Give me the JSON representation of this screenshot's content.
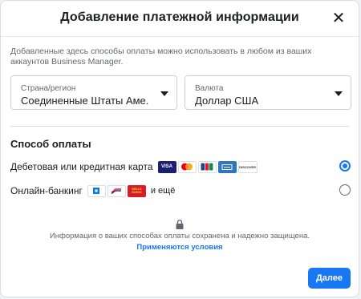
{
  "dialog": {
    "title": "Добавление платежной информации",
    "intro": "Добавленные здесь способы оплаты можно использовать в любом из ваших аккаунтов Business Manager."
  },
  "country": {
    "label": "Страна/регион",
    "value": "Соединенные Штаты Аме..."
  },
  "currency": {
    "label": "Валюта",
    "value": "Доллар США"
  },
  "payment_method": {
    "title": "Способ оплаты",
    "options": [
      {
        "label": "Дебетовая или кредитная карта",
        "selected": true,
        "logos": [
          "visa",
          "mastercard",
          "jcb",
          "amex",
          "discover"
        ]
      },
      {
        "label": "Онлайн-банкинг",
        "selected": false,
        "logos": [
          "chase",
          "bank-of-america",
          "wells-fargo"
        ],
        "more": "и ещё"
      }
    ]
  },
  "card_logos": {
    "visa": "VISA",
    "discover": "DISCOVER",
    "wells_fargo": "WELLS FARGO"
  },
  "footer": {
    "secure_text": "Информация о ваших способах оплаты сохранена и надежно защищена.",
    "terms_link": "Применяются условия",
    "next_button": "Далее"
  },
  "colors": {
    "accent": "#1877f2",
    "text": "#1c1e21",
    "muted": "#65676b"
  }
}
